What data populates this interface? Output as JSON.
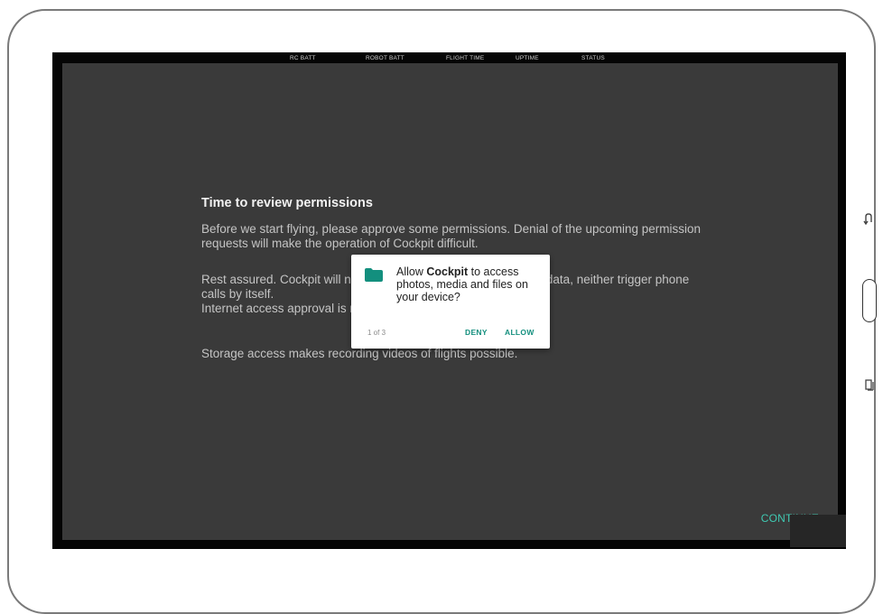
{
  "status_bar": {
    "labels": [
      "RC BATT",
      "ROBOT BATT",
      "FLIGHT TIME",
      "UPTIME",
      "STATUS"
    ]
  },
  "intro": {
    "title": "Time to review permissions",
    "paragraph1": "Before we start flying, please approve some permissions. Denial of the upcoming permission requests will make the operation of Cockpit difficult.",
    "paragraph2_line1": "Rest assured. Cockpit will not access your contacts or personal data, neither trigger phone calls by itself.",
    "paragraph2_line2": "Internet access approval is mandatory for the basic operation.",
    "paragraph3": "Storage access makes recording videos of flights possible."
  },
  "dialog": {
    "prefix": "Allow ",
    "app_name": "Cockpit",
    "suffix": " to access photos, media and files on your device?",
    "counter": "1 of 3",
    "deny_label": "DENY",
    "allow_label": "ALLOW",
    "icon": "folder-icon",
    "icon_color": "#138f7e"
  },
  "continue_label": "CONTINUE",
  "nav": {
    "back_icon": "back-icon",
    "home_icon": "home-button-icon",
    "recents_icon": "recents-icon"
  },
  "colors": {
    "accent": "#3fc9b2",
    "dialog_button": "#138f7e",
    "background": "#3a3a3a"
  }
}
